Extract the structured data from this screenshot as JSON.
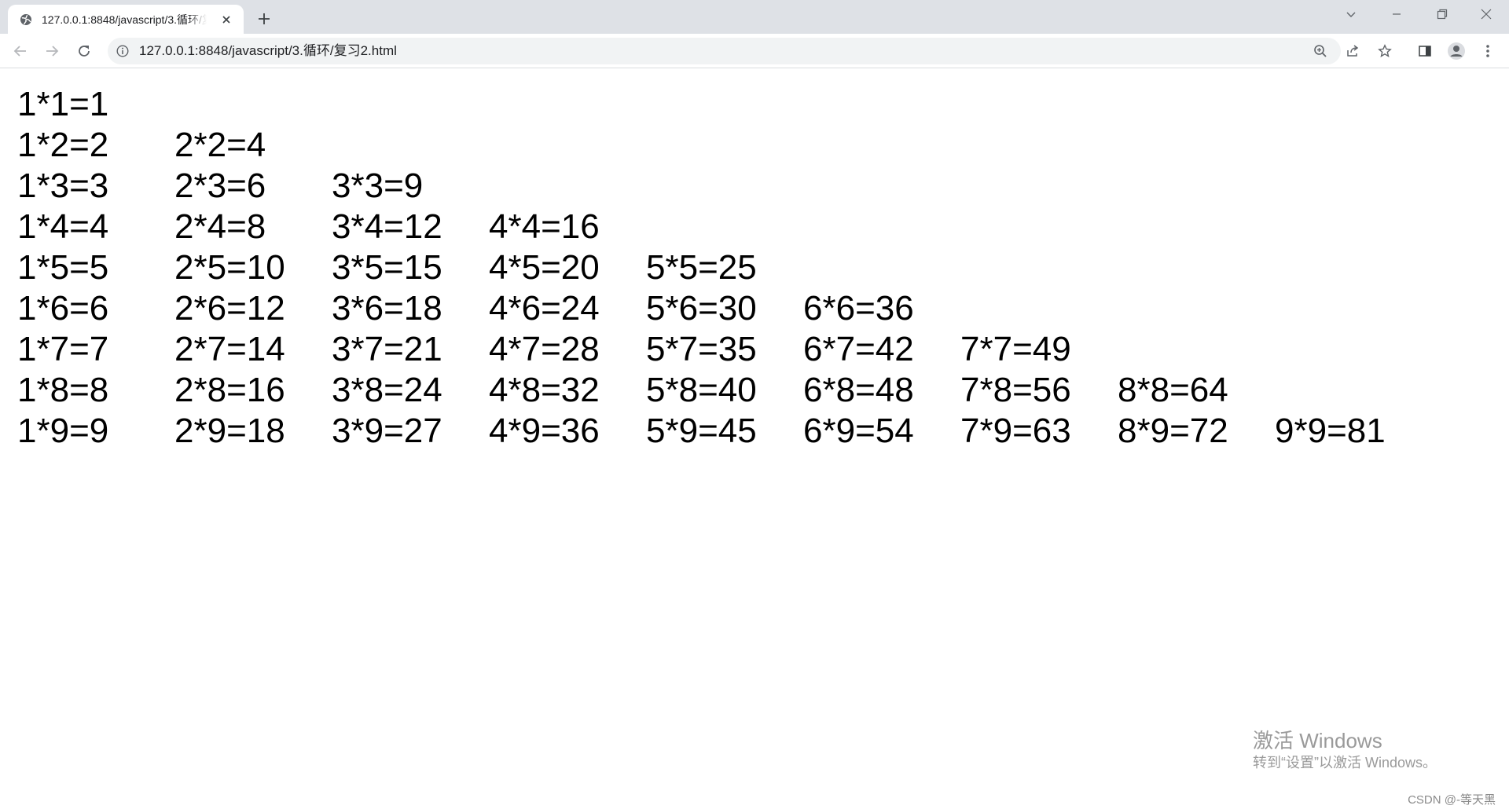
{
  "browser": {
    "tab_title": "127.0.0.1:8848/javascript/3.循环/复习2.html",
    "address": "127.0.0.1:8848/javascript/3.循环/复习2.html"
  },
  "page": {
    "rows": [
      [
        "1*1=1"
      ],
      [
        "1*2=2",
        "2*2=4"
      ],
      [
        "1*3=3",
        "2*3=6",
        "3*3=9"
      ],
      [
        "1*4=4",
        "2*4=8",
        "3*4=12",
        "4*4=16"
      ],
      [
        "1*5=5",
        "2*5=10",
        "3*5=15",
        "4*5=20",
        "5*5=25"
      ],
      [
        "1*6=6",
        "2*6=12",
        "3*6=18",
        "4*6=24",
        "5*6=30",
        "6*6=36"
      ],
      [
        "1*7=7",
        "2*7=14",
        "3*7=21",
        "4*7=28",
        "5*7=35",
        "6*7=42",
        "7*7=49"
      ],
      [
        "1*8=8",
        "2*8=16",
        "3*8=24",
        "4*8=32",
        "5*8=40",
        "6*8=48",
        "7*8=56",
        "8*8=64"
      ],
      [
        "1*9=9",
        "2*9=18",
        "3*9=27",
        "4*9=36",
        "5*9=45",
        "6*9=54",
        "7*9=63",
        "8*9=72",
        "9*9=81"
      ]
    ]
  },
  "overlay": {
    "activation_title": "激活 Windows",
    "activation_sub": "转到“设置”以激活 Windows。",
    "csdn": "CSDN @-等天黑"
  }
}
